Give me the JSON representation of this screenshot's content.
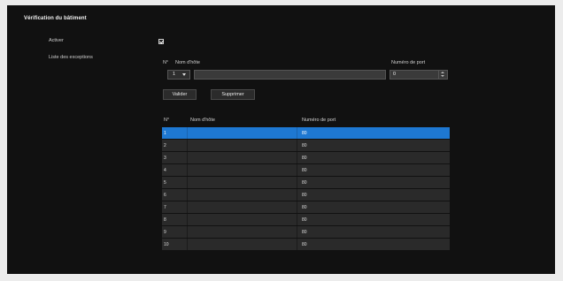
{
  "section": {
    "title": "Vérification du bâtiment"
  },
  "labels": {
    "active": "Activer",
    "exceptions": "Liste des exceptions"
  },
  "active_checked": true,
  "form": {
    "no_header": "N°",
    "host_header": "Nom d'hôte",
    "port_header": "Numéro de port",
    "no_value": "1",
    "host_value": "",
    "port_value": "0"
  },
  "buttons": {
    "add": "Valider",
    "delete": "Supprimer"
  },
  "table": {
    "headers": [
      "N°",
      "Nom d'hôte",
      "Numéro de port"
    ],
    "rows": [
      {
        "no": "1",
        "host": "",
        "port": "80"
      },
      {
        "no": "2",
        "host": "",
        "port": "80"
      },
      {
        "no": "3",
        "host": "",
        "port": "80"
      },
      {
        "no": "4",
        "host": "",
        "port": "80"
      },
      {
        "no": "5",
        "host": "",
        "port": "80"
      },
      {
        "no": "6",
        "host": "",
        "port": "80"
      },
      {
        "no": "7",
        "host": "",
        "port": "80"
      },
      {
        "no": "8",
        "host": "",
        "port": "80"
      },
      {
        "no": "9",
        "host": "",
        "port": "80"
      },
      {
        "no": "10",
        "host": "",
        "port": "80"
      }
    ],
    "selected_index": 0
  },
  "colors": {
    "panel_bg": "#111111",
    "selected_row": "#1e78d2",
    "row_bg": "#2a2a2a"
  }
}
